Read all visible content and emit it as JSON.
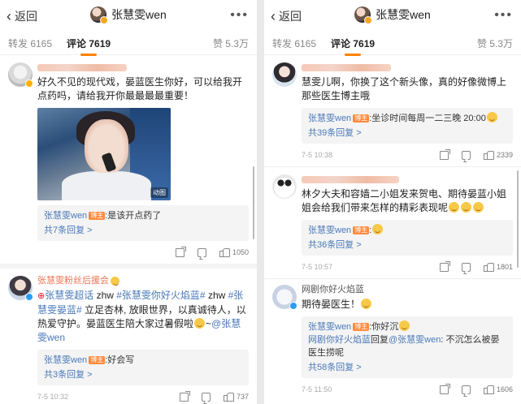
{
  "left": {
    "header": {
      "back_label": "返回",
      "title": "张慧雯wen",
      "more": "•••"
    },
    "tabs": {
      "repost": "转发 6165",
      "comment": "评论 7619",
      "like": "赞 5.3万"
    },
    "comments": [
      {
        "text": "好久不见的现代戏，晏蓝医生你好，可以给我开点药吗，请给我开你最最最最重要！",
        "media_badge": "动图",
        "replies": [
          {
            "name": "张慧雯wen",
            "chip": "博主",
            "text": ":是该开点药了"
          }
        ],
        "more_replies": "共7条回复 >",
        "time": "",
        "like_count": "1050"
      },
      {
        "name": "张慧雯粉丝后援会",
        "text_parts": [
          "张慧雯超话",
          " zhw ",
          "#张慧雯你好火焰蓝#",
          " zhw ",
          "#张慧雯晏蓝#",
          " 立足杏林, 放眼世界，以真诚待人，以热爱守护。晏蓝医生陪大家过暑假啦",
          "~",
          "@张慧雯wen"
        ],
        "replies": [
          {
            "name": "张慧雯wen",
            "chip": "博主",
            "text": ":好会写"
          }
        ],
        "more_replies": "共3条回复 >",
        "time": "7-5 10:32",
        "like_count": "737"
      }
    ]
  },
  "right": {
    "header": {
      "back_label": "返回",
      "title": "张慧雯wen",
      "more": "•••"
    },
    "tabs": {
      "repost": "转发 6165",
      "comment": "评论 7619",
      "like": "赞 5.3万"
    },
    "comments": [
      {
        "text": "慧雯儿啊，你换了这个新头像，真的好像微博上那些医生博主哦",
        "replies": [
          {
            "name": "张慧雯wen",
            "chip": "博主",
            "text": ":坐诊时间每周一二三晚 20:00"
          }
        ],
        "more_replies": "共39条回复 >",
        "time": "7-5 10:38",
        "like_count": "2339"
      },
      {
        "text": "林夕大夫和容嫱二小姐发来贺电、期待晏蓝小姐姐会给我们带来怎样的精彩表现呢",
        "replies": [
          {
            "name": "张慧雯wen",
            "chip": "博主",
            "text": ":"
          }
        ],
        "more_replies": "共36条回复 >",
        "time": "7-5 10:57",
        "like_count": "1801"
      },
      {
        "name": "网剧你好火焰蓝",
        "text": "期待晏医生！",
        "replies": [
          {
            "name": "张慧雯wen",
            "chip": "博主",
            "text": ":你好沉"
          },
          {
            "name": "网剧你好火焰蓝",
            "text_mid": "回复",
            "at": "@张慧雯wen",
            "text": ": 不沉怎么被晏医生捞呢"
          }
        ],
        "more_replies": "共58条回复 >",
        "time": "7-5 11:50",
        "like_count": "1606"
      }
    ]
  },
  "colors": {
    "accent": "#ff8200",
    "link": "#4a78b8",
    "username": "#eb7350"
  },
  "icons": [
    "back-chevron-icon",
    "more-icon",
    "share-icon",
    "comment-icon",
    "like-icon",
    "verified-badge-icon",
    "emoji-icon"
  ]
}
